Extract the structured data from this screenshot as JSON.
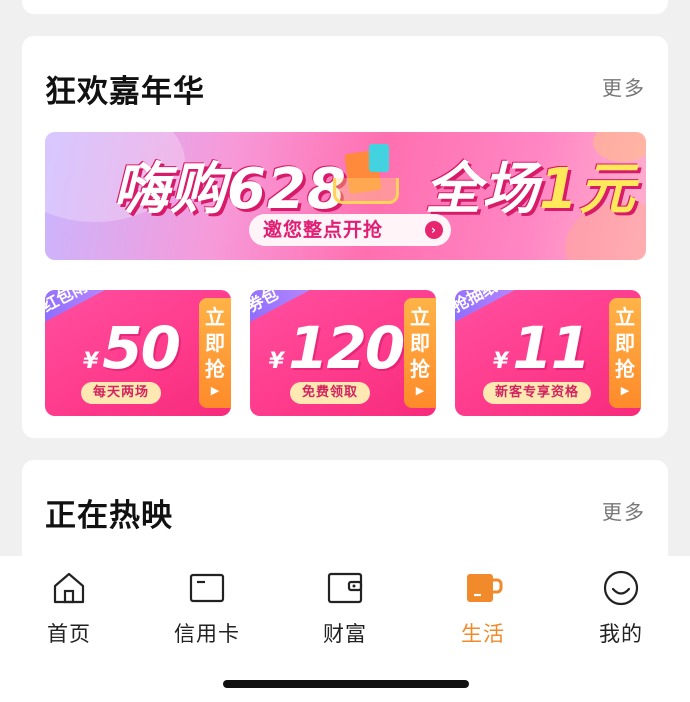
{
  "carnival": {
    "title": "狂欢嘉年华",
    "more": "更多",
    "banner": {
      "title_left": "嗨购628",
      "title_right_a": "全场",
      "title_right_b": "1元",
      "subtitle": "邀您整点开抢",
      "arrow": "›"
    },
    "coupons": [
      {
        "tag": "红包雨",
        "yen": "¥",
        "amount": "50",
        "note": "每天两场",
        "action": "立即抢"
      },
      {
        "tag": "券包",
        "yen": "¥",
        "amount": "120",
        "note": "免费领取",
        "action": "立即抢"
      },
      {
        "tag": "抢抽纸",
        "yen": "¥",
        "amount": "11",
        "note": "新客专享资格",
        "action": "立即抢"
      }
    ],
    "action_chars": [
      "立",
      "即",
      "抢"
    ],
    "action_arrow": "▶"
  },
  "movies": {
    "title": "正在热映",
    "more": "更多"
  },
  "tabbar": {
    "items": [
      {
        "label": "首页",
        "icon": "home-icon"
      },
      {
        "label": "信用卡",
        "icon": "credit-card-icon"
      },
      {
        "label": "财富",
        "icon": "wallet-icon"
      },
      {
        "label": "生活",
        "icon": "cup-icon",
        "active": true
      },
      {
        "label": "我的",
        "icon": "smiley-icon"
      }
    ],
    "active_color": "#f08a2a"
  }
}
